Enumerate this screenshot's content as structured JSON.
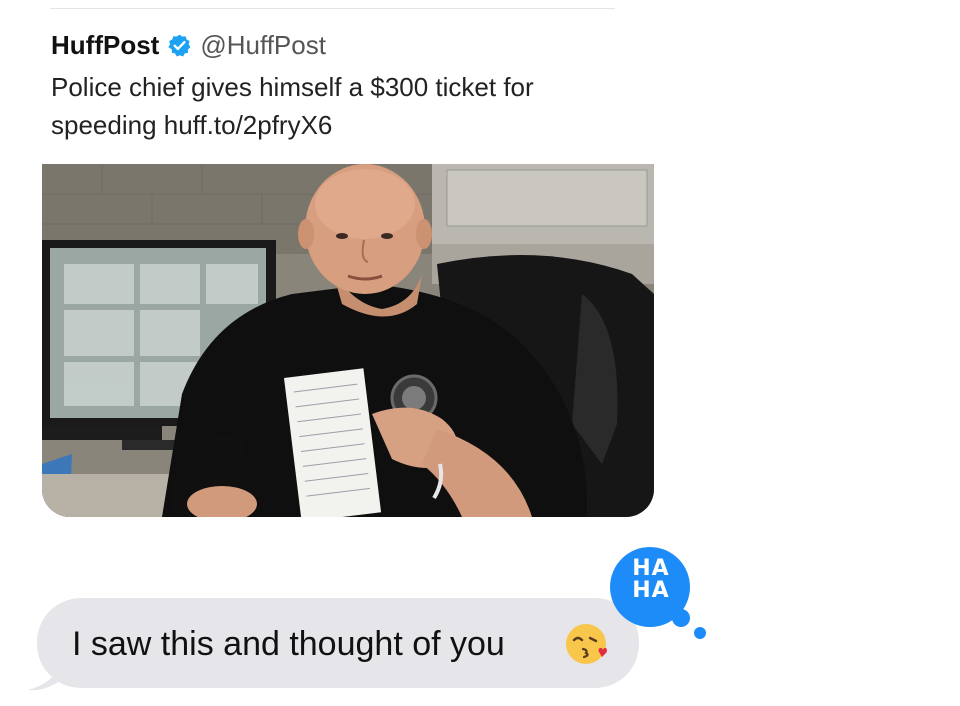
{
  "tweet": {
    "author_name": "HuffPost",
    "verified_icon": "verified-badge-icon",
    "author_handle": "@HuffPost",
    "text": "Police chief gives himself a $300 ticket for speeding huff.to/2pfryX6",
    "media_icon": "photo-thumbnail"
  },
  "message": {
    "text": "I saw this and thought of you",
    "emoji_icon": "face-blowing-kiss-icon",
    "bubble_color": "#e6e6ea"
  },
  "tapback": {
    "label": "HA\nHA",
    "icon": "haha-reaction-icon",
    "color": "#1d8cf8"
  },
  "colors": {
    "verified_blue": "#1da1f2",
    "text": "#111111"
  }
}
